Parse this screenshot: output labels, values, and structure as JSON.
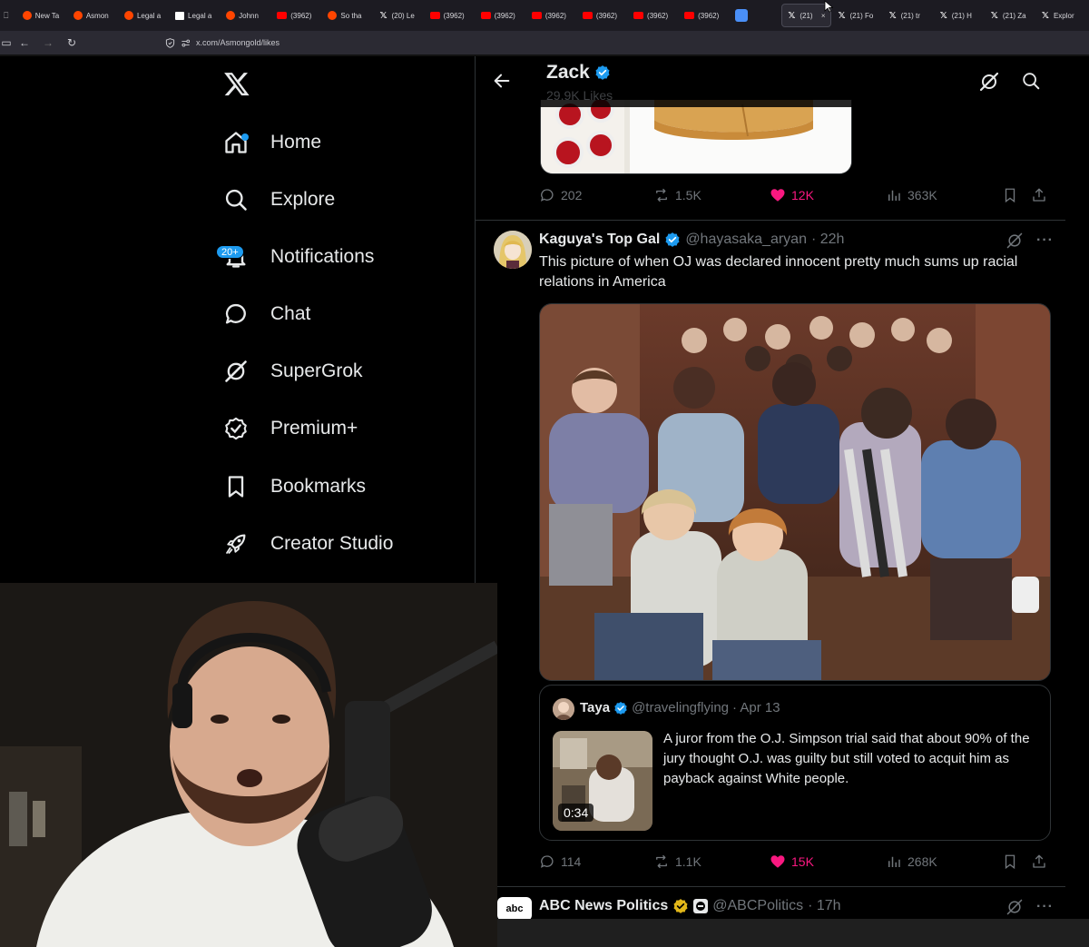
{
  "browser": {
    "tabs": [
      {
        "label": "New Ta",
        "icon": "reddit-icon"
      },
      {
        "label": "Asmon",
        "icon": "reddit-icon"
      },
      {
        "label": "Legal a",
        "icon": "reddit-icon"
      },
      {
        "label": "Legal a",
        "icon": "document-icon"
      },
      {
        "label": "Johnn",
        "icon": "reddit-icon"
      },
      {
        "label": "(3962)",
        "icon": "youtube-icon"
      },
      {
        "label": "So tha",
        "icon": "reddit-icon"
      },
      {
        "label": "(20) Le",
        "icon": "x-icon"
      },
      {
        "label": "(3962)",
        "icon": "youtube-icon"
      },
      {
        "label": "(3962)",
        "icon": "youtube-icon"
      },
      {
        "label": "(3962)",
        "icon": "youtube-icon"
      },
      {
        "label": "(3962)",
        "icon": "youtube-icon"
      },
      {
        "label": "(3962)",
        "icon": "youtube-icon"
      },
      {
        "label": "(3962)",
        "icon": "youtube-icon"
      },
      {
        "label": "",
        "icon": "blue-tile-icon"
      },
      {
        "label": "(21)",
        "icon": "x-icon",
        "active": true
      },
      {
        "label": "(21) Fo",
        "icon": "x-icon"
      },
      {
        "label": "(21) tr",
        "icon": "x-icon"
      },
      {
        "label": "(21) H",
        "icon": "x-icon"
      },
      {
        "label": "(21) Za",
        "icon": "x-icon"
      },
      {
        "label": "Explor",
        "icon": "x-icon"
      }
    ],
    "url": "x.com/Asmongold/likes"
  },
  "sidebar": {
    "items": [
      {
        "label": "Home",
        "icon": "home-icon"
      },
      {
        "label": "Explore",
        "icon": "search-icon"
      },
      {
        "label": "Notifications",
        "icon": "bell-icon",
        "badge": "20+"
      },
      {
        "label": "Chat",
        "icon": "chat-bubble-icon"
      },
      {
        "label": "SuperGrok",
        "icon": "grok-icon"
      },
      {
        "label": "Premium+",
        "icon": "verified-badge-icon"
      },
      {
        "label": "Bookmarks",
        "icon": "bookmark-icon"
      },
      {
        "label": "Creator Studio",
        "icon": "rocket-icon"
      }
    ]
  },
  "header": {
    "name": "Zack",
    "likes_count": "29.9K Likes"
  },
  "tweet1": {
    "replies": "202",
    "reposts": "1.5K",
    "likes": "12K",
    "views": "363K"
  },
  "tweet2": {
    "name": "Kaguya's Top Gal",
    "handle": "@hayasaka_aryan",
    "time": "· 22h",
    "text": "This picture of when OJ was declared innocent pretty much sums up racial relations in America",
    "replies": "114",
    "reposts": "1.1K",
    "likes": "15K",
    "views": "268K",
    "quote": {
      "name": "Taya",
      "handle": "@travelingflying",
      "time": "· Apr 13",
      "text": "A juror from the O.J. Simpson trial said that about 90% of the jury thought O.J. was guilty but still voted to acquit him as payback against White people.",
      "video_duration": "0:34"
    }
  },
  "tweet3": {
    "avatar_text": "abc",
    "name": "ABC News Politics",
    "handle": "@ABCPolitics",
    "time": "· 17h"
  },
  "colors": {
    "accent": "#1d9bf0",
    "like": "#f91880",
    "gold_badge": "#e2b719",
    "muted": "#71767b"
  }
}
